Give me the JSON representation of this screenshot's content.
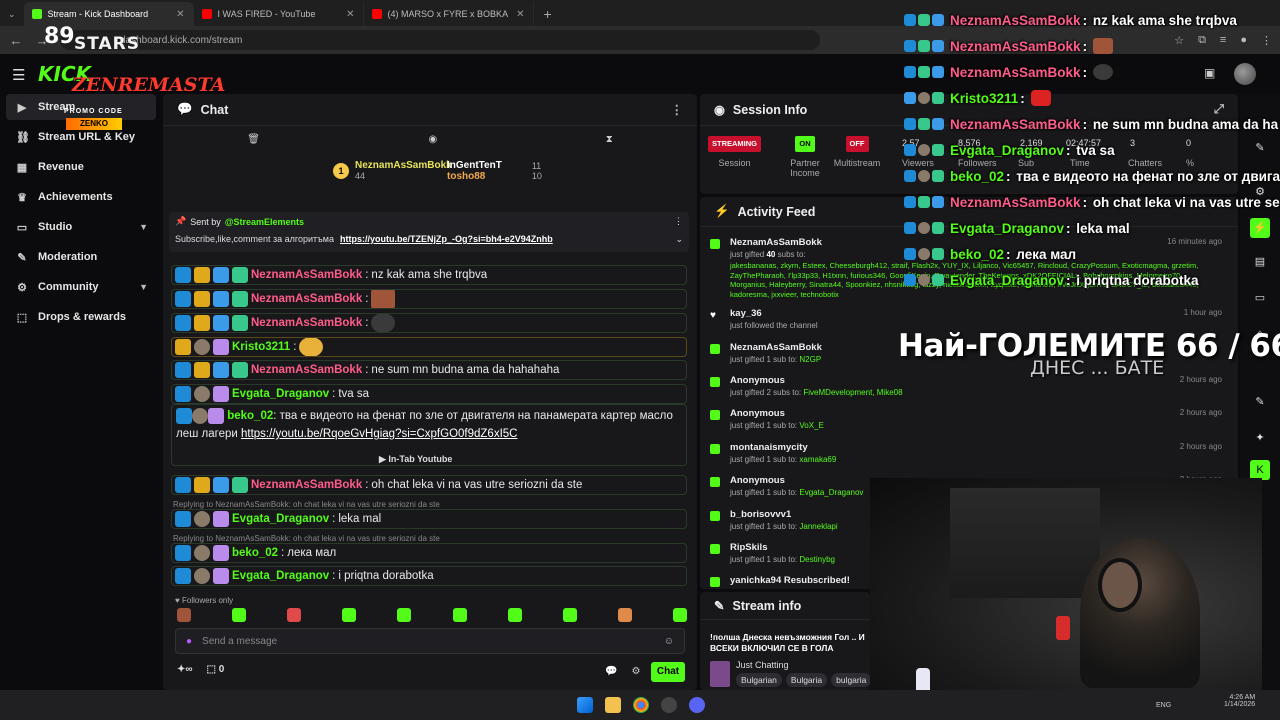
{
  "browser": {
    "tabs": [
      {
        "label": "Stream - Kick Dashboard",
        "color": "#53fc18"
      },
      {
        "label": "I WAS FIRED - YouTube",
        "color": "#ff0000"
      },
      {
        "label": "(4) MARSO x FYRE x BOBKA",
        "color": "#ff0000"
      }
    ],
    "new_tab": "+",
    "url": "dashboard.kick.com/stream"
  },
  "overlay_logo": {
    "num": "89",
    "stars": "STARS",
    "kick": "KICK",
    "zen": "ZENREMASTA",
    "promo": "PROMO CODE",
    "code": "ZENKO"
  },
  "sidebar": {
    "items": [
      {
        "label": "Stream",
        "icon": "video-icon"
      },
      {
        "label": "Stream URL & Key",
        "icon": "link-icon"
      },
      {
        "label": "Revenue",
        "icon": "chart-icon"
      },
      {
        "label": "Achievements",
        "icon": "trophy-icon"
      },
      {
        "label": "Studio",
        "icon": "monitor-icon"
      },
      {
        "label": "Moderation",
        "icon": "wrench-icon"
      },
      {
        "label": "Community",
        "icon": "gear-icon"
      },
      {
        "label": "Drops & rewards",
        "icon": "gift-icon"
      }
    ]
  },
  "chat": {
    "title": "Chat",
    "leaderboard": [
      {
        "rank": "1",
        "name": "NeznamAsSamBokk",
        "count": "44"
      },
      {
        "name": "InGentTenT",
        "count": "11"
      },
      {
        "name": "tosho88",
        "count": "10"
      }
    ],
    "pinned": {
      "sent_by_label": "Sent by",
      "sender": "@StreamElements",
      "text": "Subscribe,like,comment за алгоритъма",
      "link": "https://youtu.be/TZENjZp_-Og?si=bh4-e2V94Znhb"
    },
    "messages": [
      {
        "user": "NeznamAsSamBokk",
        "text": "nz kak ama she trqbva"
      },
      {
        "user": "NeznamAsSamBokk",
        "text": ""
      },
      {
        "user": "NeznamAsSamBokk",
        "text": ""
      },
      {
        "user": "Kristo3211",
        "text": ""
      },
      {
        "user": "NeznamAsSamBokk",
        "text": "ne sum mn budna ama da hahahaha"
      },
      {
        "user": "Evgata_Draganov",
        "text": "tva sa"
      }
    ],
    "long_message": {
      "user": "beko_02",
      "text": "тва е видеото на фенат по зле от двигателя на панамерата картер масло леш лагери",
      "link": "https://youtu.be/RqoeGvHgiag?si=CxpfGO0f9dZ6xI5C"
    },
    "in_tab_label": "In-Tab Youtube",
    "messages2": [
      {
        "user": "NeznamAsSamBokk",
        "text": "oh chat leka vi na vas utre seriozni da ste"
      },
      {
        "reply": "Replying to NeznamAsSamBokk: oh chat leka vi na vas utre seriozni da ste",
        "user": "Evgata_Draganov",
        "text": "leka mal"
      },
      {
        "reply": "Replying to NeznamAsSamBokk: oh chat leka vi na vas utre seriozni da ste",
        "user": "beko_02",
        "text": "лека мал"
      },
      {
        "user": "Evgata_Draganov",
        "text": "i priqtna dorabotka"
      }
    ],
    "followers_only": "Followers only",
    "placeholder": "Send a message",
    "infinity": "∞",
    "count": "0",
    "send_label": "Chat"
  },
  "session": {
    "title": "Session Info",
    "streaming": "STREAMING",
    "session_label": "Session",
    "on": "ON",
    "partner": "Partner Income",
    "off": "OFF",
    "multistream": "Multistream",
    "stats": [
      {
        "value": "2.57",
        "label": "Viewers"
      },
      {
        "value": "8,576",
        "label": "Followers"
      },
      {
        "value": "2,169",
        "label": "Sub"
      },
      {
        "value": "02:47:57",
        "label": "Time"
      },
      {
        "value": "3",
        "label": "Chatters"
      },
      {
        "value": "0",
        "label": "%"
      }
    ]
  },
  "activity": {
    "title": "Activity Feed",
    "items": [
      {
        "name": "NeznamAsSamBokk",
        "desc_pre": "just gifted",
        "count": "40",
        "desc_mid": "subs to:",
        "time": "16 minutes ago",
        "list": "jakesbananas, zkyrn, Esteex, Cheeseburgh412, straif, Flash2x, YUY_IX, Liljanco, Vic65457, Rincloud, CrazyPossum, Exoticmagma, grzetim, ZayThePharaoh, I'lp33p33, H1txnn, furious346, GoonfiKevin, Rwautender, TheKetonns, xDK2OFFICIALx, Bobchompkins, Melometro70, Morganius, Haleyberry, Sinatra44, Spoonkiez, nhsniktlog, luzzy, nicdbinasoxx, Zyqlux2, Mohanow, hVoJrDUjEnYJ, SAUCY_IZ, bossake3445, kadoresma, jxxvieer, technobotix"
      },
      {
        "name": "kay_36",
        "desc": "just followed the channel",
        "time": "1 hour ago"
      },
      {
        "name": "NeznamAsSamBokk",
        "desc": "just gifted 1 sub to:",
        "target": "N2GP",
        "time": ""
      },
      {
        "name": "Anonymous",
        "desc": "just gifted 2 subs to:",
        "target": "FiveMDevelopment, Mike08",
        "time": "2 hours ago"
      },
      {
        "name": "Anonymous",
        "desc": "just gifted 1 sub to:",
        "target": "VoX_E",
        "time": "2 hours ago"
      },
      {
        "name": "montanaismycity",
        "desc": "just gifted 1 sub to:",
        "target": "xamaka69",
        "time": "2 hours ago"
      },
      {
        "name": "Anonymous",
        "desc": "just gifted 1 sub to:",
        "target": "Evgata_Draganov",
        "time": "2 hours ago"
      },
      {
        "name": "b_borisovvv1",
        "desc": "just gifted 1 sub to:",
        "target": "Janneklapi",
        "time": ""
      },
      {
        "name": "RipSkils",
        "desc": "just gifted 1 sub to:",
        "target": "Destinybg",
        "time": ""
      },
      {
        "name": "yanichka94 Resubscribed!",
        "desc": "",
        "time": ""
      }
    ]
  },
  "stream_info": {
    "title": "Stream info",
    "stream_title": "!полша Днеска невъзможния Гол .. И ВСЕКИ ВКЛЮЧИЛ СЕ В ГОЛА",
    "category": "Just Chatting",
    "tags": [
      "Bulgarian",
      "Bulgaria",
      "bulgaria"
    ]
  },
  "overlay_chat": [
    {
      "user": "NeznamAsSamBokk",
      "text": "nz kak ama she trqbva",
      "color": "#ff5c8a"
    },
    {
      "user": "NeznamAsSamBokk",
      "text": "",
      "color": "#ff5c8a"
    },
    {
      "user": "NeznamAsSamBokk",
      "text": "",
      "color": "#ff5c8a"
    },
    {
      "user": "Kristo3211",
      "text": "",
      "color": "#53fc18"
    },
    {
      "user": "NeznamAsSamBokk",
      "text": "ne sum mn budna ama da ha",
      "color": "#ff5c8a"
    },
    {
      "user": "Evgata_Draganov",
      "text": "tva sa",
      "color": "#53fc18"
    },
    {
      "user": "beko_02",
      "text": "тва е видеото на фенат по зле от двига",
      "color": "#53fc18"
    },
    {
      "user": "NeznamAsSamBokk",
      "text": "oh chat leka vi na vas utre se",
      "color": "#ff5c8a"
    },
    {
      "user": "Evgata_Draganov",
      "text": "leka mal",
      "color": "#53fc18"
    },
    {
      "user": "beko_02",
      "text": "лека мал",
      "color": "#53fc18"
    },
    {
      "user": "Evgata_Draganov",
      "text": "i priqtna dorabotka",
      "color": "#53fc18"
    }
  ],
  "overlay_title": "Най-ГОЛЕМИТЕ 66 / 66",
  "overlay_subtitle": "ДНЕС ... БАТЕ",
  "tray": {
    "lang": "ENG",
    "time": "4:26 AM",
    "date": "1/14/2026"
  },
  "colors": {
    "kick_green": "#53fc18",
    "panel": "#18181b",
    "bg": "#0b0b0d",
    "username_pink": "#ff5c8a"
  }
}
